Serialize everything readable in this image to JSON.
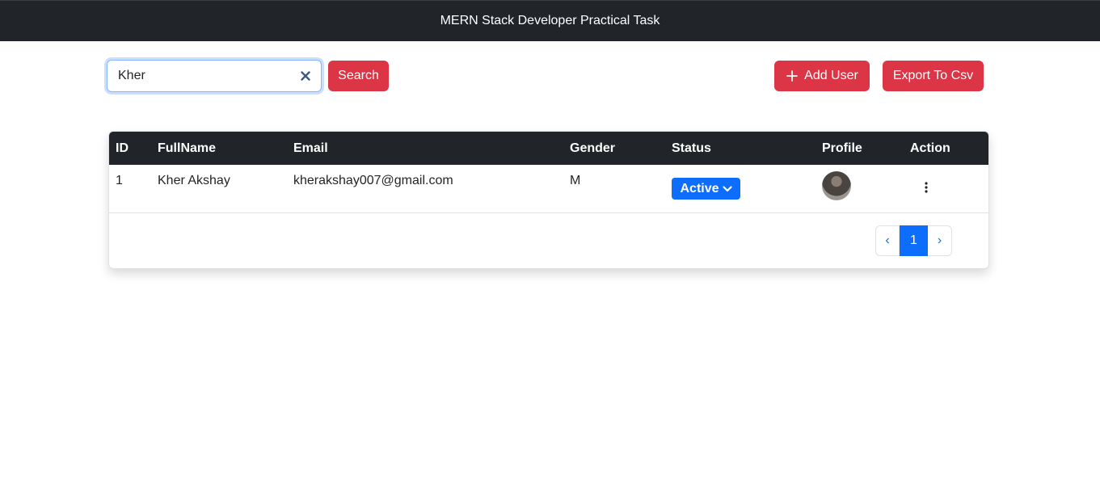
{
  "app": {
    "title": "MERN Stack Developer Practical Task"
  },
  "search": {
    "value": "Kher",
    "button_label": "Search"
  },
  "actions": {
    "add_user_label": "Add User",
    "export_label": "Export To Csv"
  },
  "table": {
    "columns": [
      "ID",
      "FullName",
      "Email",
      "Gender",
      "Status",
      "Profile",
      "Action"
    ],
    "rows": [
      {
        "id": "1",
        "fullname": "Kher Akshay",
        "email": "kherakshay007@gmail.com",
        "gender": "M",
        "status": "Active"
      }
    ]
  },
  "pagination": {
    "prev": "‹",
    "current": "1",
    "next": "›"
  },
  "icons": {
    "clear": "clear-x-icon",
    "add": "plus-icon",
    "status_dropdown": "chevron-down-icon",
    "action": "kebab-menu-icon"
  },
  "colors": {
    "navbar": "#212529",
    "danger": "#dc3545",
    "primary": "#0d6efd",
    "table_header": "#212529"
  }
}
